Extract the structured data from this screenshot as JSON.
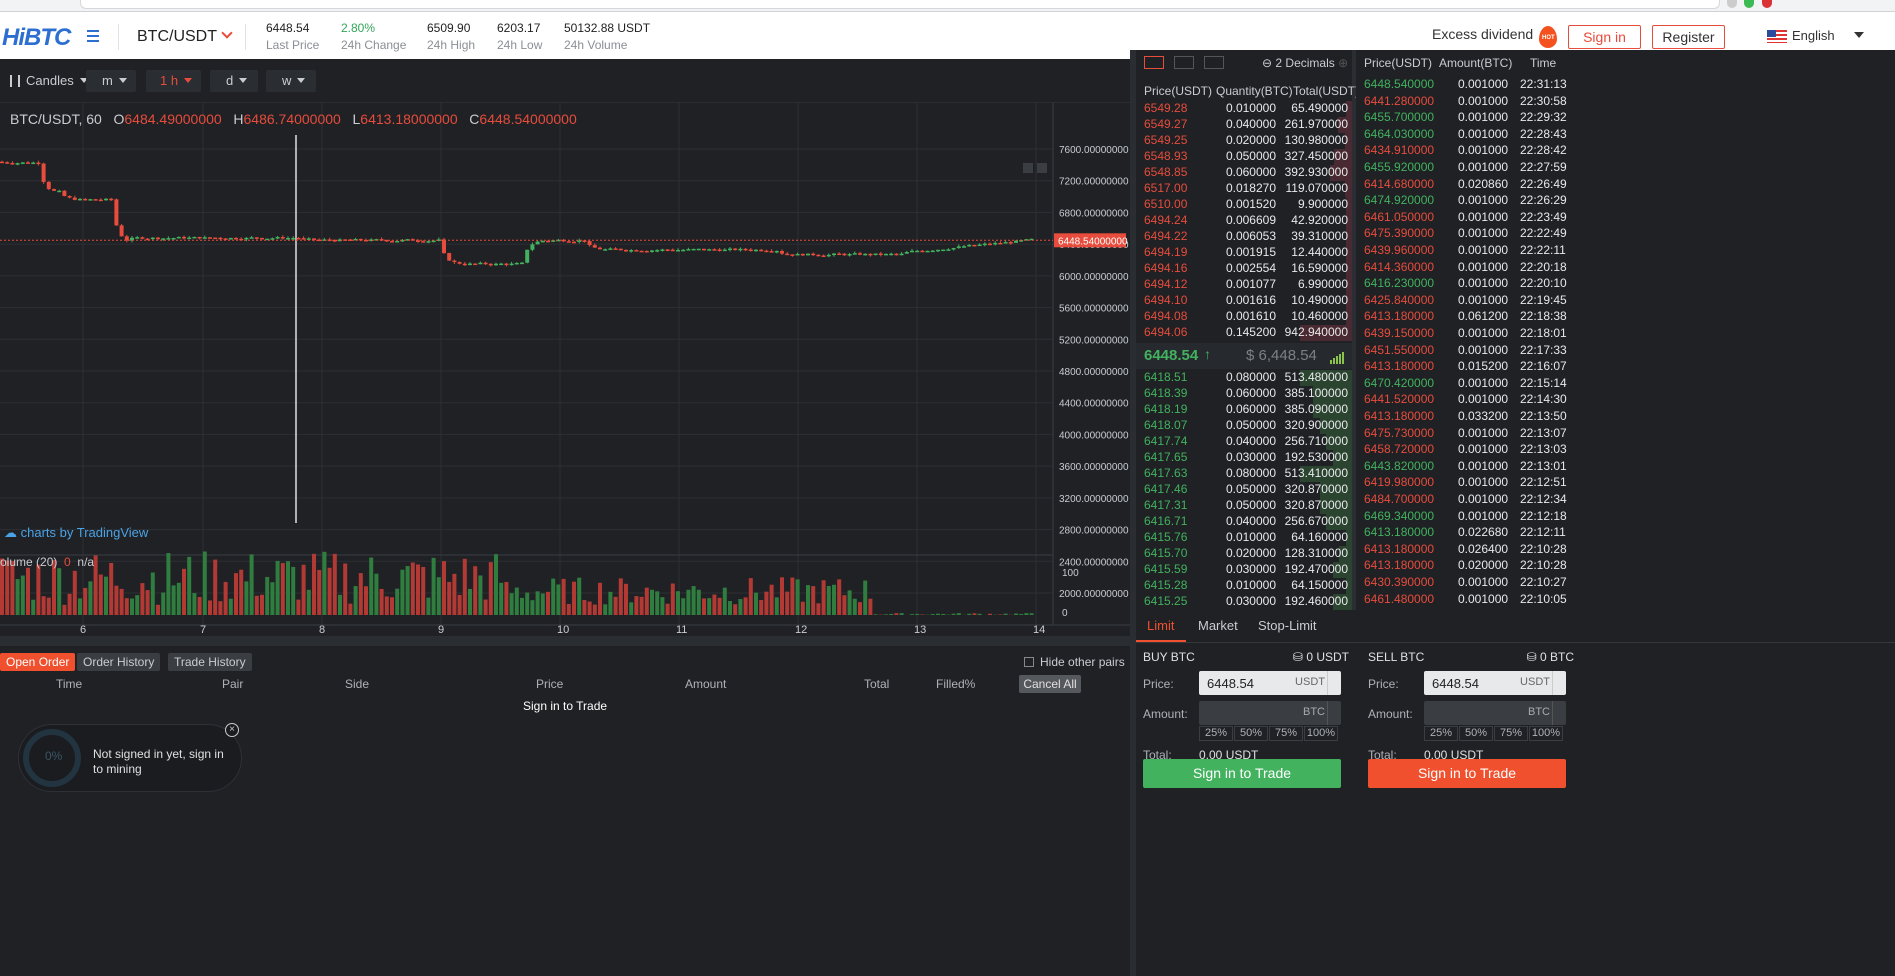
{
  "header": {
    "logo": "HiBTC",
    "pair": "BTC/USDT",
    "stats": [
      {
        "value": "6448.54",
        "label": "Last Price"
      },
      {
        "value": "2.80%",
        "label": "24h Change"
      },
      {
        "value": "6509.90",
        "label": "24h High"
      },
      {
        "value": "6203.17",
        "label": "24h Low"
      },
      {
        "value": "50132.88 USDT",
        "label": "24h Volume"
      }
    ],
    "excess": "Excess dividend",
    "hot": "HOT",
    "signin": "Sign in",
    "register": "Register",
    "language": "English"
  },
  "toolbar": {
    "candles": "Candles",
    "m": "m",
    "h": "1 h",
    "d": "d",
    "w": "w"
  },
  "ohlc": {
    "pair": "BTC/USDT, 60",
    "o_label": "O",
    "o": "6484.49000000",
    "h_label": "H",
    "h": "6486.74000000",
    "l_label": "L",
    "l": "6413.18000000",
    "c_label": "C",
    "c": "6448.54000000"
  },
  "chart_labels": {
    "tradingview": "charts by TradingView",
    "volume": "olume (20)",
    "vol_zero": "0",
    "vol_na": "n/a"
  },
  "chart_data": {
    "type": "candlestick",
    "y_ticks": [
      "7600.00000000",
      "7200.00000000",
      "6800.00000000",
      "6400.00000000",
      "6000.00000000",
      "5600.00000000",
      "5200.00000000",
      "4800.00000000",
      "4400.00000000",
      "4000.00000000",
      "3600.00000000",
      "3200.00000000",
      "2800.00000000",
      "2400.00000000",
      "2000.00000000"
    ],
    "ylim": [
      2000,
      7600
    ],
    "last_price_label": "6448.54000000",
    "last_price": 6448.54,
    "x_ticks": [
      "6",
      "7",
      "8",
      "9",
      "10",
      "11",
      "12",
      "13",
      "14"
    ],
    "volume_ticks": [
      "100",
      "0"
    ],
    "volume_max": 100
  },
  "book": {
    "decimals": "2 Decimals",
    "headers": [
      "Price(USDT)",
      "Quantity(BTC)",
      "Total(USDT)"
    ],
    "asks": [
      [
        "6549.28",
        "0.010000",
        "65.490000"
      ],
      [
        "6549.27",
        "0.040000",
        "261.970000"
      ],
      [
        "6549.25",
        "0.020000",
        "130.980000"
      ],
      [
        "6548.93",
        "0.050000",
        "327.450000"
      ],
      [
        "6548.85",
        "0.060000",
        "392.930000"
      ],
      [
        "6517.00",
        "0.018270",
        "119.070000"
      ],
      [
        "6510.00",
        "0.001520",
        "9.900000"
      ],
      [
        "6494.24",
        "0.006609",
        "42.920000"
      ],
      [
        "6494.22",
        "0.006053",
        "39.310000"
      ],
      [
        "6494.19",
        "0.001915",
        "12.440000"
      ],
      [
        "6494.16",
        "0.002554",
        "16.590000"
      ],
      [
        "6494.12",
        "0.001077",
        "6.990000"
      ],
      [
        "6494.10",
        "0.001616",
        "10.490000"
      ],
      [
        "6494.08",
        "0.001610",
        "10.460000"
      ],
      [
        "6494.06",
        "0.145200",
        "942.940000"
      ]
    ],
    "mid_price": "6448.54",
    "mid_arrow": "↑",
    "mid_usd": "$ 6,448.54",
    "bids": [
      [
        "6418.51",
        "0.080000",
        "513.480000"
      ],
      [
        "6418.39",
        "0.060000",
        "385.100000"
      ],
      [
        "6418.19",
        "0.060000",
        "385.090000"
      ],
      [
        "6418.07",
        "0.050000",
        "320.900000"
      ],
      [
        "6417.74",
        "0.040000",
        "256.710000"
      ],
      [
        "6417.65",
        "0.030000",
        "192.530000"
      ],
      [
        "6417.63",
        "0.080000",
        "513.410000"
      ],
      [
        "6417.46",
        "0.050000",
        "320.870000"
      ],
      [
        "6417.31",
        "0.050000",
        "320.870000"
      ],
      [
        "6416.71",
        "0.040000",
        "256.670000"
      ],
      [
        "6415.76",
        "0.010000",
        "64.160000"
      ],
      [
        "6415.70",
        "0.020000",
        "128.310000"
      ],
      [
        "6415.59",
        "0.030000",
        "192.470000"
      ],
      [
        "6415.28",
        "0.010000",
        "64.150000"
      ],
      [
        "6415.25",
        "0.030000",
        "192.460000"
      ]
    ]
  },
  "trades": {
    "headers": [
      "Price(USDT)",
      "Amount(BTC)",
      "Time"
    ],
    "rows": [
      [
        "6448.540000",
        "0.001000",
        "22:31:13",
        "g"
      ],
      [
        "6441.280000",
        "0.001000",
        "22:30:58",
        "r"
      ],
      [
        "6455.700000",
        "0.001000",
        "22:29:32",
        "g"
      ],
      [
        "6464.030000",
        "0.001000",
        "22:28:43",
        "g"
      ],
      [
        "6434.910000",
        "0.001000",
        "22:28:42",
        "r"
      ],
      [
        "6455.920000",
        "0.001000",
        "22:27:59",
        "g"
      ],
      [
        "6414.680000",
        "0.020860",
        "22:26:49",
        "r"
      ],
      [
        "6474.920000",
        "0.001000",
        "22:26:29",
        "g"
      ],
      [
        "6461.050000",
        "0.001000",
        "22:23:49",
        "r"
      ],
      [
        "6475.390000",
        "0.001000",
        "22:22:49",
        "r"
      ],
      [
        "6439.960000",
        "0.001000",
        "22:22:11",
        "r"
      ],
      [
        "6414.360000",
        "0.001000",
        "22:20:18",
        "r"
      ],
      [
        "6416.230000",
        "0.001000",
        "22:20:10",
        "g"
      ],
      [
        "6425.840000",
        "0.001000",
        "22:19:45",
        "r"
      ],
      [
        "6413.180000",
        "0.061200",
        "22:18:38",
        "r"
      ],
      [
        "6439.150000",
        "0.001000",
        "22:18:01",
        "r"
      ],
      [
        "6451.550000",
        "0.001000",
        "22:17:33",
        "r"
      ],
      [
        "6413.180000",
        "0.015200",
        "22:16:07",
        "r"
      ],
      [
        "6470.420000",
        "0.001000",
        "22:15:14",
        "g"
      ],
      [
        "6441.520000",
        "0.001000",
        "22:14:30",
        "r"
      ],
      [
        "6413.180000",
        "0.033200",
        "22:13:50",
        "r"
      ],
      [
        "6475.730000",
        "0.001000",
        "22:13:07",
        "r"
      ],
      [
        "6458.720000",
        "0.001000",
        "22:13:03",
        "r"
      ],
      [
        "6443.820000",
        "0.001000",
        "22:13:01",
        "g"
      ],
      [
        "6419.980000",
        "0.001000",
        "22:12:51",
        "r"
      ],
      [
        "6484.700000",
        "0.001000",
        "22:12:34",
        "r"
      ],
      [
        "6469.340000",
        "0.001000",
        "22:12:18",
        "g"
      ],
      [
        "6413.180000",
        "0.022680",
        "22:12:11",
        "g"
      ],
      [
        "6413.180000",
        "0.026400",
        "22:10:28",
        "r"
      ],
      [
        "6413.180000",
        "0.020000",
        "22:10:28",
        "r"
      ],
      [
        "6430.390000",
        "0.001000",
        "22:10:27",
        "r"
      ],
      [
        "6461.480000",
        "0.001000",
        "22:10:05",
        "r"
      ]
    ]
  },
  "orders": {
    "tabs": [
      "Open Order",
      "Order History",
      "Trade History"
    ],
    "hide_other": "Hide other pairs",
    "headers": [
      "Time",
      "Pair",
      "Side",
      "Price",
      "Amount",
      "Total",
      "Filled%"
    ],
    "cancel_all": "Cancel All",
    "empty": "Sign in to Trade"
  },
  "mining": {
    "pct": "0%",
    "text": "Not signed in yet, sign in to mining",
    "close": "×"
  },
  "trade_form": {
    "tabs": [
      "Limit",
      "Market",
      "Stop-Limit"
    ],
    "buy": {
      "title": "BUY BTC",
      "balance": "0 USDT",
      "price_label": "Price:",
      "price": "6448.54",
      "price_unit": "USDT",
      "amount_label": "Amount:",
      "amount_unit": "BTC",
      "pcts": [
        "25%",
        "50%",
        "75%",
        "100%"
      ],
      "total_label": "Total:",
      "total": "0.00 USDT",
      "button": "Sign in to Trade"
    },
    "sell": {
      "title": "SELL BTC",
      "balance": "0 BTC",
      "price_label": "Price:",
      "price": "6448.54",
      "price_unit": "USDT",
      "amount_label": "Amount:",
      "amount_unit": "BTC",
      "pcts": [
        "25%",
        "50%",
        "75%",
        "100%"
      ],
      "total_label": "Total:",
      "total": "0.00 USDT",
      "button": "Sign in to Trade"
    }
  },
  "colors": {
    "up": "#42b25e",
    "down": "#e74c3c",
    "accent": "#f0502d"
  }
}
